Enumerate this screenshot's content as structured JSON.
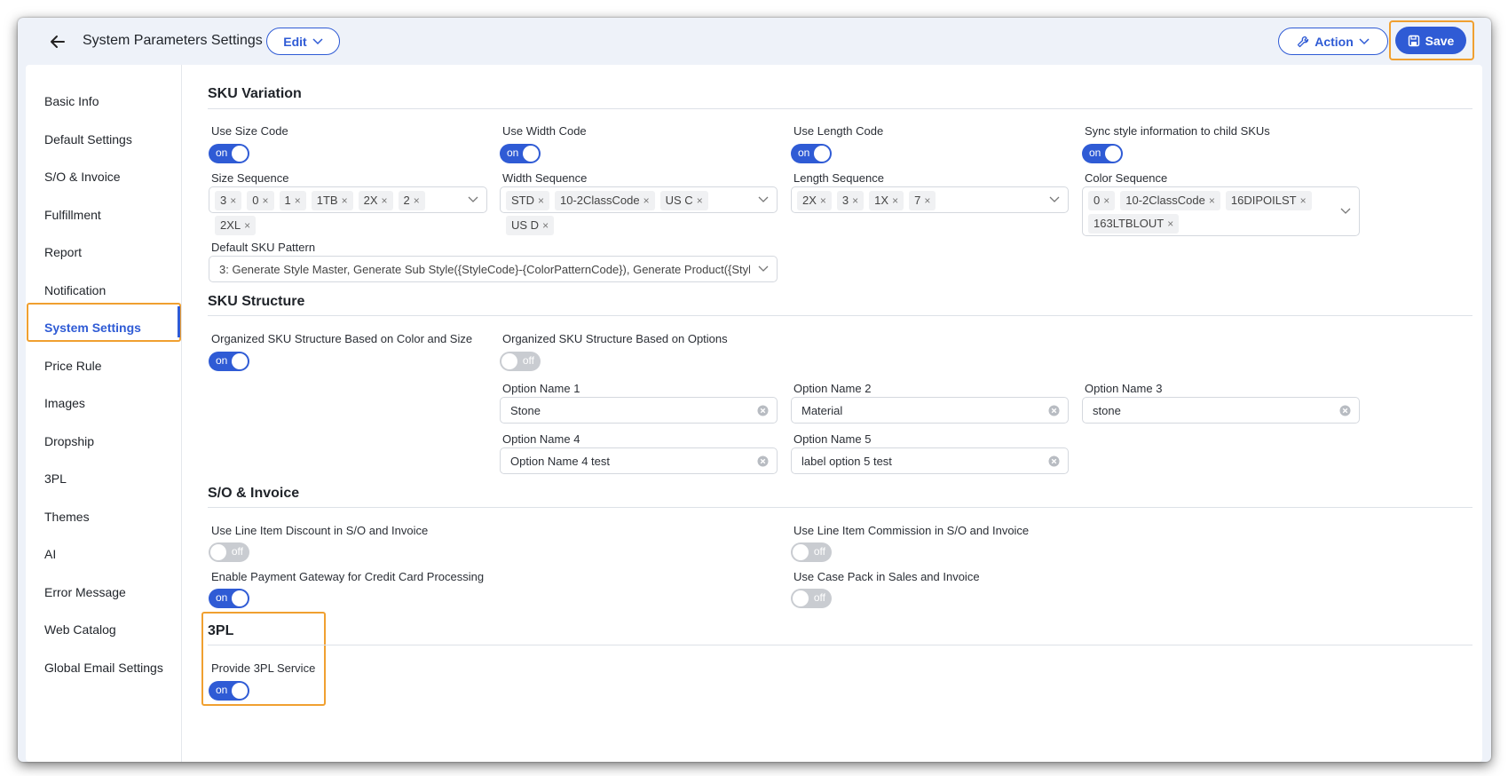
{
  "header": {
    "title": "System Parameters Settings",
    "edit_label": "Edit",
    "action_label": "Action",
    "save_label": "Save"
  },
  "sidebar": {
    "items": [
      {
        "label": "Basic Info"
      },
      {
        "label": "Default Settings"
      },
      {
        "label": "S/O & Invoice"
      },
      {
        "label": "Fulfillment"
      },
      {
        "label": "Report"
      },
      {
        "label": "Notification"
      },
      {
        "label": "System Settings"
      },
      {
        "label": "Price Rule"
      },
      {
        "label": "Images"
      },
      {
        "label": "Dropship"
      },
      {
        "label": "3PL"
      },
      {
        "label": "Themes"
      },
      {
        "label": "AI"
      },
      {
        "label": "Error Message"
      },
      {
        "label": "Web Catalog"
      },
      {
        "label": "Global Email Settings"
      }
    ],
    "active": "System Settings"
  },
  "sku_variation": {
    "title": "SKU Variation",
    "use_size_code": {
      "label": "Use Size Code",
      "state": "on"
    },
    "use_width_code": {
      "label": "Use Width Code",
      "state": "on"
    },
    "use_length_code": {
      "label": "Use Length Code",
      "state": "on"
    },
    "sync_style": {
      "label": "Sync style information to child SKUs",
      "state": "on"
    },
    "size_sequence": {
      "label": "Size Sequence",
      "tags": [
        "3",
        "0",
        "1",
        "1TB",
        "2X",
        "2",
        "2XL"
      ]
    },
    "width_sequence": {
      "label": "Width Sequence",
      "tags": [
        "STD",
        "10-2ClassCode",
        "US C",
        "US D"
      ]
    },
    "length_sequence": {
      "label": "Length Sequence",
      "tags": [
        "2X",
        "3",
        "1X",
        "7"
      ]
    },
    "color_sequence": {
      "label": "Color Sequence",
      "tags": [
        "0",
        "10-2ClassCode",
        "16DIPOILST",
        "163LTBLOUT"
      ]
    },
    "default_sku_pattern": {
      "label": "Default SKU Pattern",
      "value": "3: Generate Style Master, Generate Sub Style({StyleCode}-{ColorPatternCode}), Generate Product({StyleC..."
    }
  },
  "sku_structure": {
    "title": "SKU Structure",
    "color_size": {
      "label": "Organized SKU Structure Based on Color and Size",
      "state": "on"
    },
    "options": {
      "label": "Organized SKU Structure Based on Options",
      "state": "off"
    },
    "option1": {
      "label": "Option Name 1",
      "value": "Stone"
    },
    "option2": {
      "label": "Option Name 2",
      "value": "Material"
    },
    "option3": {
      "label": "Option Name 3",
      "value": "stone"
    },
    "option4": {
      "label": "Option Name 4",
      "value": "Option Name 4 test"
    },
    "option5": {
      "label": "Option Name 5",
      "value": "label option 5 test"
    }
  },
  "so_invoice": {
    "title": "S/O & Invoice",
    "line_discount": {
      "label": "Use Line Item Discount in S/O and Invoice",
      "state": "off"
    },
    "line_commission": {
      "label": "Use Line Item Commission in S/O and Invoice",
      "state": "off"
    },
    "payment_gateway": {
      "label": "Enable Payment Gateway for Credit Card Processing",
      "state": "on"
    },
    "case_pack": {
      "label": "Use Case Pack in Sales and Invoice",
      "state": "off"
    }
  },
  "tpl": {
    "title": "3PL",
    "provide_service": {
      "label": "Provide 3PL Service",
      "state": "on"
    }
  },
  "colors": {
    "accent": "#2f5bd5",
    "highlight": "#f0a030",
    "toggle_off": "#c9ccd1"
  }
}
